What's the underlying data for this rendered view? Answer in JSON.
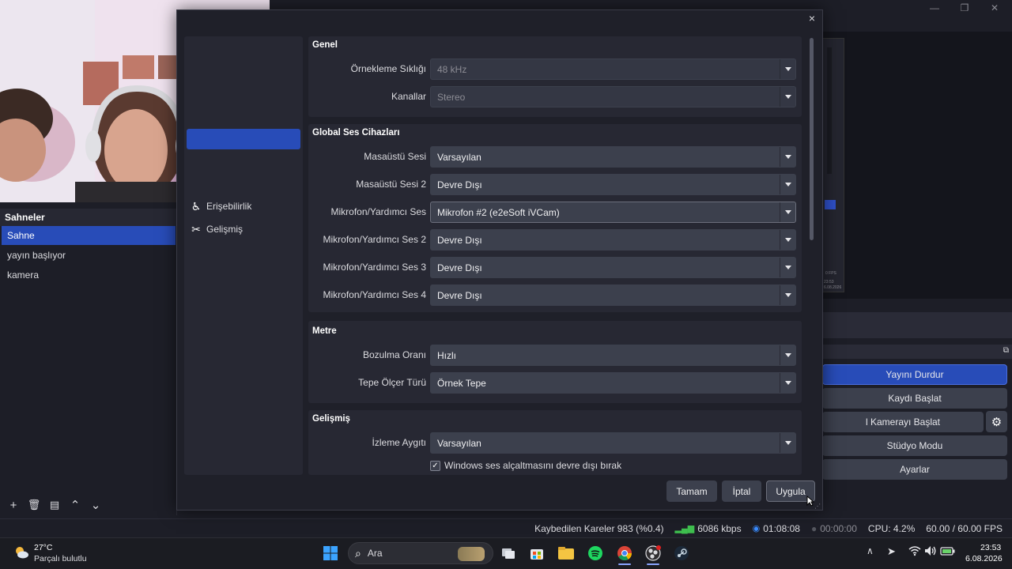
{
  "dialog": {
    "close_label": "×",
    "nav": [
      {
        "label": "Erişebilirlik",
        "icon": "accessibility-icon"
      },
      {
        "label": "Gelişmiş",
        "icon": "tools-icon"
      }
    ],
    "groups": {
      "general": {
        "title": "Genel",
        "sample_rate_label": "Örnekleme Sıklığı",
        "sample_rate_value": "48 kHz",
        "channels_label": "Kanallar",
        "channels_value": "Stereo"
      },
      "global_devices": {
        "title": "Global Ses Cihazları",
        "rows": [
          {
            "label": "Masaüstü Sesi",
            "value": "Varsayılan"
          },
          {
            "label": "Masaüstü Sesi 2",
            "value": "Devre Dışı"
          },
          {
            "label": "Mikrofon/Yardımcı Ses",
            "value": "Mikrofon #2 (e2eSoft iVCam)"
          },
          {
            "label": "Mikrofon/Yardımcı Ses 2",
            "value": "Devre Dışı"
          },
          {
            "label": "Mikrofon/Yardımcı Ses 3",
            "value": "Devre Dışı"
          },
          {
            "label": "Mikrofon/Yardımcı Ses 4",
            "value": "Devre Dışı"
          }
        ]
      },
      "meters": {
        "title": "Metre",
        "decay_label": "Bozulma Oranı",
        "decay_value": "Hızlı",
        "peak_label": "Tepe Ölçer Türü",
        "peak_value": "Örnek Tepe"
      },
      "advanced": {
        "title": "Gelişmiş",
        "monitoring_label": "İzleme Aygıtı",
        "monitoring_value": "Varsayılan",
        "ducking_label": "Windows ses alçaltmasını devre dışı bırak",
        "ducking_checked": true
      }
    },
    "buttons": {
      "ok": "Tamam",
      "cancel": "İptal",
      "apply": "Uygula"
    }
  },
  "scenes": {
    "title": "Sahneler",
    "items": [
      "Sahne",
      "yayın başlıyor",
      "kamera"
    ],
    "selected_index": 0,
    "toolbar": {
      "add": "+",
      "remove": "🗑",
      "filter": "▤",
      "up": "⌃",
      "down": "⌄"
    }
  },
  "controls": {
    "stop_stream": "Yayını Durdur",
    "start_recording": "Kaydı Başlat",
    "start_vcam": "l Kamerayı Başlat",
    "studio_mode": "Stüdyo Modu",
    "settings": "Ayarlar"
  },
  "status": {
    "dropped_frames": "Kaybedilen Kareler 983 (%0.4)",
    "bitrate": "6086 kbps",
    "stream_time": "01:08:08",
    "rec_time": "00:00:00",
    "cpu": "CPU: 4.2%",
    "fps": "60.00 / 60.00 FPS"
  },
  "preview_tiny": {
    "fps": "0 FPS",
    "time": "23:53",
    "date": "6.08.2026"
  },
  "taskbar": {
    "weather_temp": "27°C",
    "weather_desc": "Parçalı bulutlu",
    "search_placeholder": "Ara",
    "time": "23:53",
    "date": "6.08.2026"
  },
  "colors": {
    "accent": "#284cb8",
    "panel": "#272833",
    "input": "#3c404d",
    "background": "#1d1e27"
  }
}
